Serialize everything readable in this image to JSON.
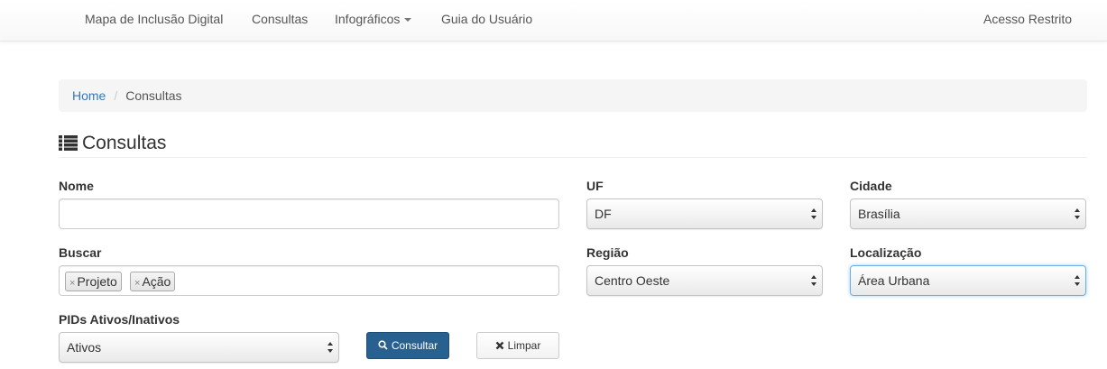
{
  "navbar": {
    "items": [
      {
        "label": "Mapa de Inclusão Digital"
      },
      {
        "label": "Consultas"
      },
      {
        "label": "Infográficos"
      },
      {
        "label": "Guia do Usuário"
      }
    ],
    "right_label": "Acesso Restrito"
  },
  "breadcrumb": {
    "home": "Home",
    "separator": "/",
    "current": "Consultas"
  },
  "page": {
    "title": "Consultas",
    "title_icon": "list-icon"
  },
  "form": {
    "nome": {
      "label": "Nome",
      "value": ""
    },
    "uf": {
      "label": "UF",
      "value": "DF"
    },
    "cidade": {
      "label": "Cidade",
      "value": "Brasília"
    },
    "buscar": {
      "label": "Buscar",
      "tags": [
        "Projeto",
        "Ação"
      ]
    },
    "regiao": {
      "label": "Região",
      "value": "Centro Oeste"
    },
    "localizacao": {
      "label": "Localização",
      "value": "Área Urbana"
    },
    "pids": {
      "label": "PIDs Ativos/Inativos",
      "value": "Ativos"
    },
    "consultar_button": {
      "label": "Consultar",
      "icon": "search-icon"
    },
    "limpar_button": {
      "label": "Limpar",
      "icon": "close-icon"
    }
  },
  "colors": {
    "link": "#337ab7",
    "primary_button": "#286090",
    "focus_border": "#66afe9"
  }
}
